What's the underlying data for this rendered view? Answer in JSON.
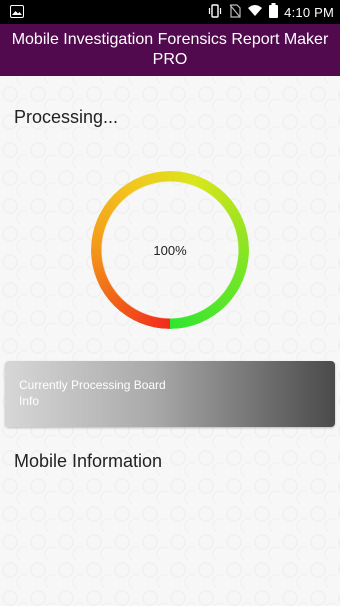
{
  "status_bar": {
    "time": "4:10 PM",
    "icons": [
      "image-icon",
      "vibrate-icon",
      "no-sim-icon",
      "wifi-icon",
      "battery-icon"
    ]
  },
  "app_bar": {
    "title": "Mobile Investigation Forensics Report Maker PRO"
  },
  "main": {
    "processing_label": "Processing...",
    "progress": {
      "percent_text": "100%",
      "value": 1.0
    },
    "current_processing": "Currently Processing Board Info",
    "section_title": "Mobile Information"
  },
  "colors": {
    "app_bar": "#520a4f",
    "gauge_start": "#f22a1e",
    "gauge_mid": "#f2c71e",
    "gauge_end": "#2fe52f"
  }
}
